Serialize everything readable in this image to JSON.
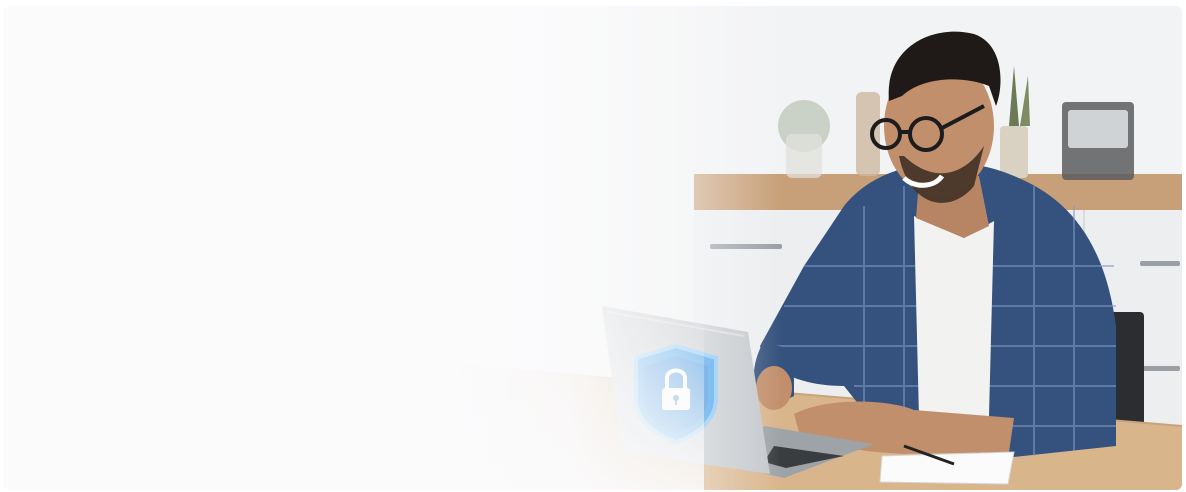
{
  "scene": {
    "subject": "person-using-laptop",
    "badge_icon": "shield-lock-icon",
    "colors": {
      "background": "#f5f6f7",
      "table": "#d8b48a",
      "shirt": "#2f4f7c",
      "laptop": "#bfc3c7",
      "shield": "#3b9be8"
    }
  }
}
